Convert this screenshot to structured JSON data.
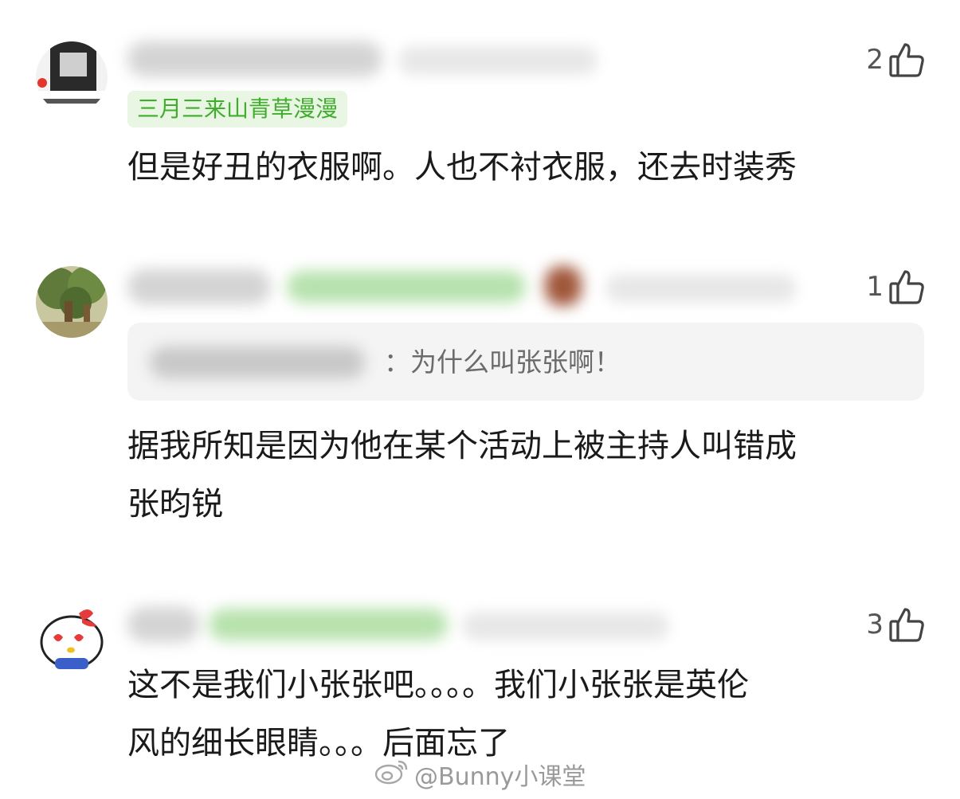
{
  "comments": [
    {
      "badge": "三月三来山青草漫漫",
      "likes": "2",
      "text": "但是好丑的衣服啊。人也不衬衣服，还去时装秀"
    },
    {
      "likes": "1",
      "quote": "：为什么叫张张啊！",
      "text_line1": "据我所知是因为他在某个活动上被主持人叫错成",
      "text_line2": "张昀锐"
    },
    {
      "likes": "3",
      "text_line1": "这不是我们小张张吧。。。。我们小张张是英伦",
      "text_line2": "风的细长眼睛。。。后面忘了"
    }
  ],
  "watermark": "@Bunny小课堂",
  "icons": {
    "like": "thumbs-up-icon",
    "watermark_logo": "weibo-logo-icon"
  },
  "colors": {
    "badge_text": "#3fae2c",
    "badge_bg": "#e9f6e4",
    "body_text": "#1a1a1a",
    "meta_text": "#555555",
    "quote_bg": "#f4f4f4"
  }
}
